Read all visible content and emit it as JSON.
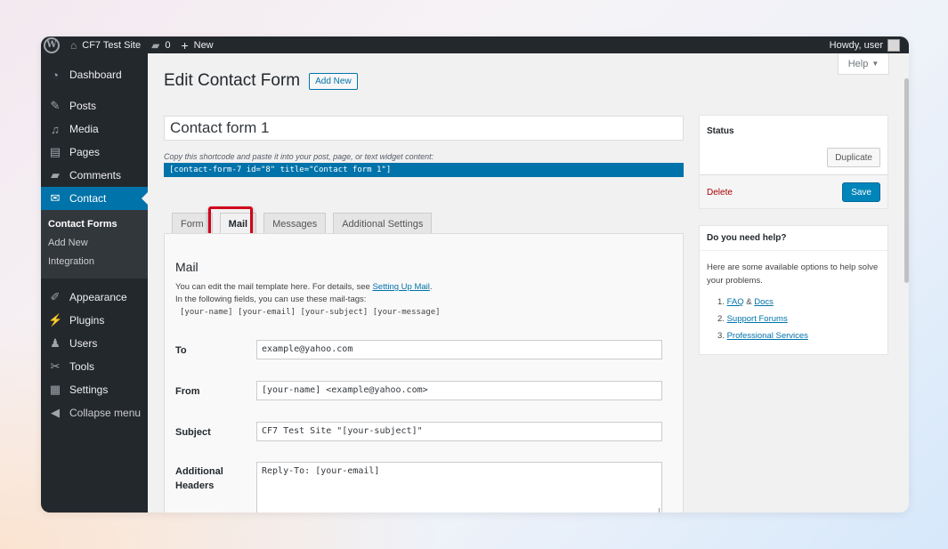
{
  "adminbar": {
    "site_name": "CF7 Test Site",
    "comments_count": "0",
    "new_label": "New",
    "howdy": "Howdy, user"
  },
  "sidebar": {
    "items": [
      {
        "label": "Dashboard",
        "icon": "dashboard-icon"
      },
      {
        "label": "Posts",
        "icon": "pin-icon"
      },
      {
        "label": "Media",
        "icon": "media-icon"
      },
      {
        "label": "Pages",
        "icon": "pages-icon"
      },
      {
        "label": "Comments",
        "icon": "comments-icon"
      },
      {
        "label": "Contact",
        "icon": "mail-icon"
      },
      {
        "label": "Appearance",
        "icon": "brush-icon"
      },
      {
        "label": "Plugins",
        "icon": "plugin-icon"
      },
      {
        "label": "Users",
        "icon": "users-icon"
      },
      {
        "label": "Tools",
        "icon": "wrench-icon"
      },
      {
        "label": "Settings",
        "icon": "settings-icon"
      },
      {
        "label": "Collapse menu",
        "icon": "collapse-icon"
      }
    ],
    "submenu": [
      "Contact Forms",
      "Add New",
      "Integration"
    ]
  },
  "header": {
    "help_label": "Help",
    "title": "Edit Contact Form",
    "add_new": "Add New"
  },
  "form": {
    "title_value": "Contact form 1",
    "shortcode_help": "Copy this shortcode and paste it into your post, page, or text widget content:",
    "shortcode": "[contact-form-7 id=\"8\" title=\"Contact form 1\"]"
  },
  "tabs": [
    "Form",
    "Mail",
    "Messages",
    "Additional Settings"
  ],
  "mail": {
    "heading": "Mail",
    "desc1_pre": "You can edit the mail template here. For details, see ",
    "desc1_link": "Setting Up Mail",
    "desc1_post": ".",
    "desc2": "In the following fields, you can use these mail-tags:",
    "tags": "[your-name] [your-email] [your-subject] [your-message]",
    "fields": {
      "to_label": "To",
      "to_value": "example@yahoo.com",
      "from_label": "From",
      "from_value": "[your-name] <example@yahoo.com>",
      "subject_label": "Subject",
      "subject_value": "CF7 Test Site \"[your-subject]\"",
      "headers_label_1": "Additional",
      "headers_label_2": "Headers",
      "headers_value": "Reply-To: [your-email]"
    }
  },
  "status": {
    "heading": "Status",
    "duplicate": "Duplicate",
    "delete": "Delete",
    "save": "Save"
  },
  "help": {
    "heading": "Do you need help?",
    "text": "Here are some available options to help solve your problems.",
    "item1_num": "1.",
    "item1_link_a": "FAQ",
    "item1_amp": " & ",
    "item1_link_b": "Docs",
    "item2_num": "2.",
    "item2_link": "Support Forums",
    "item3_num": "3.",
    "item3_link": "Professional Services"
  }
}
